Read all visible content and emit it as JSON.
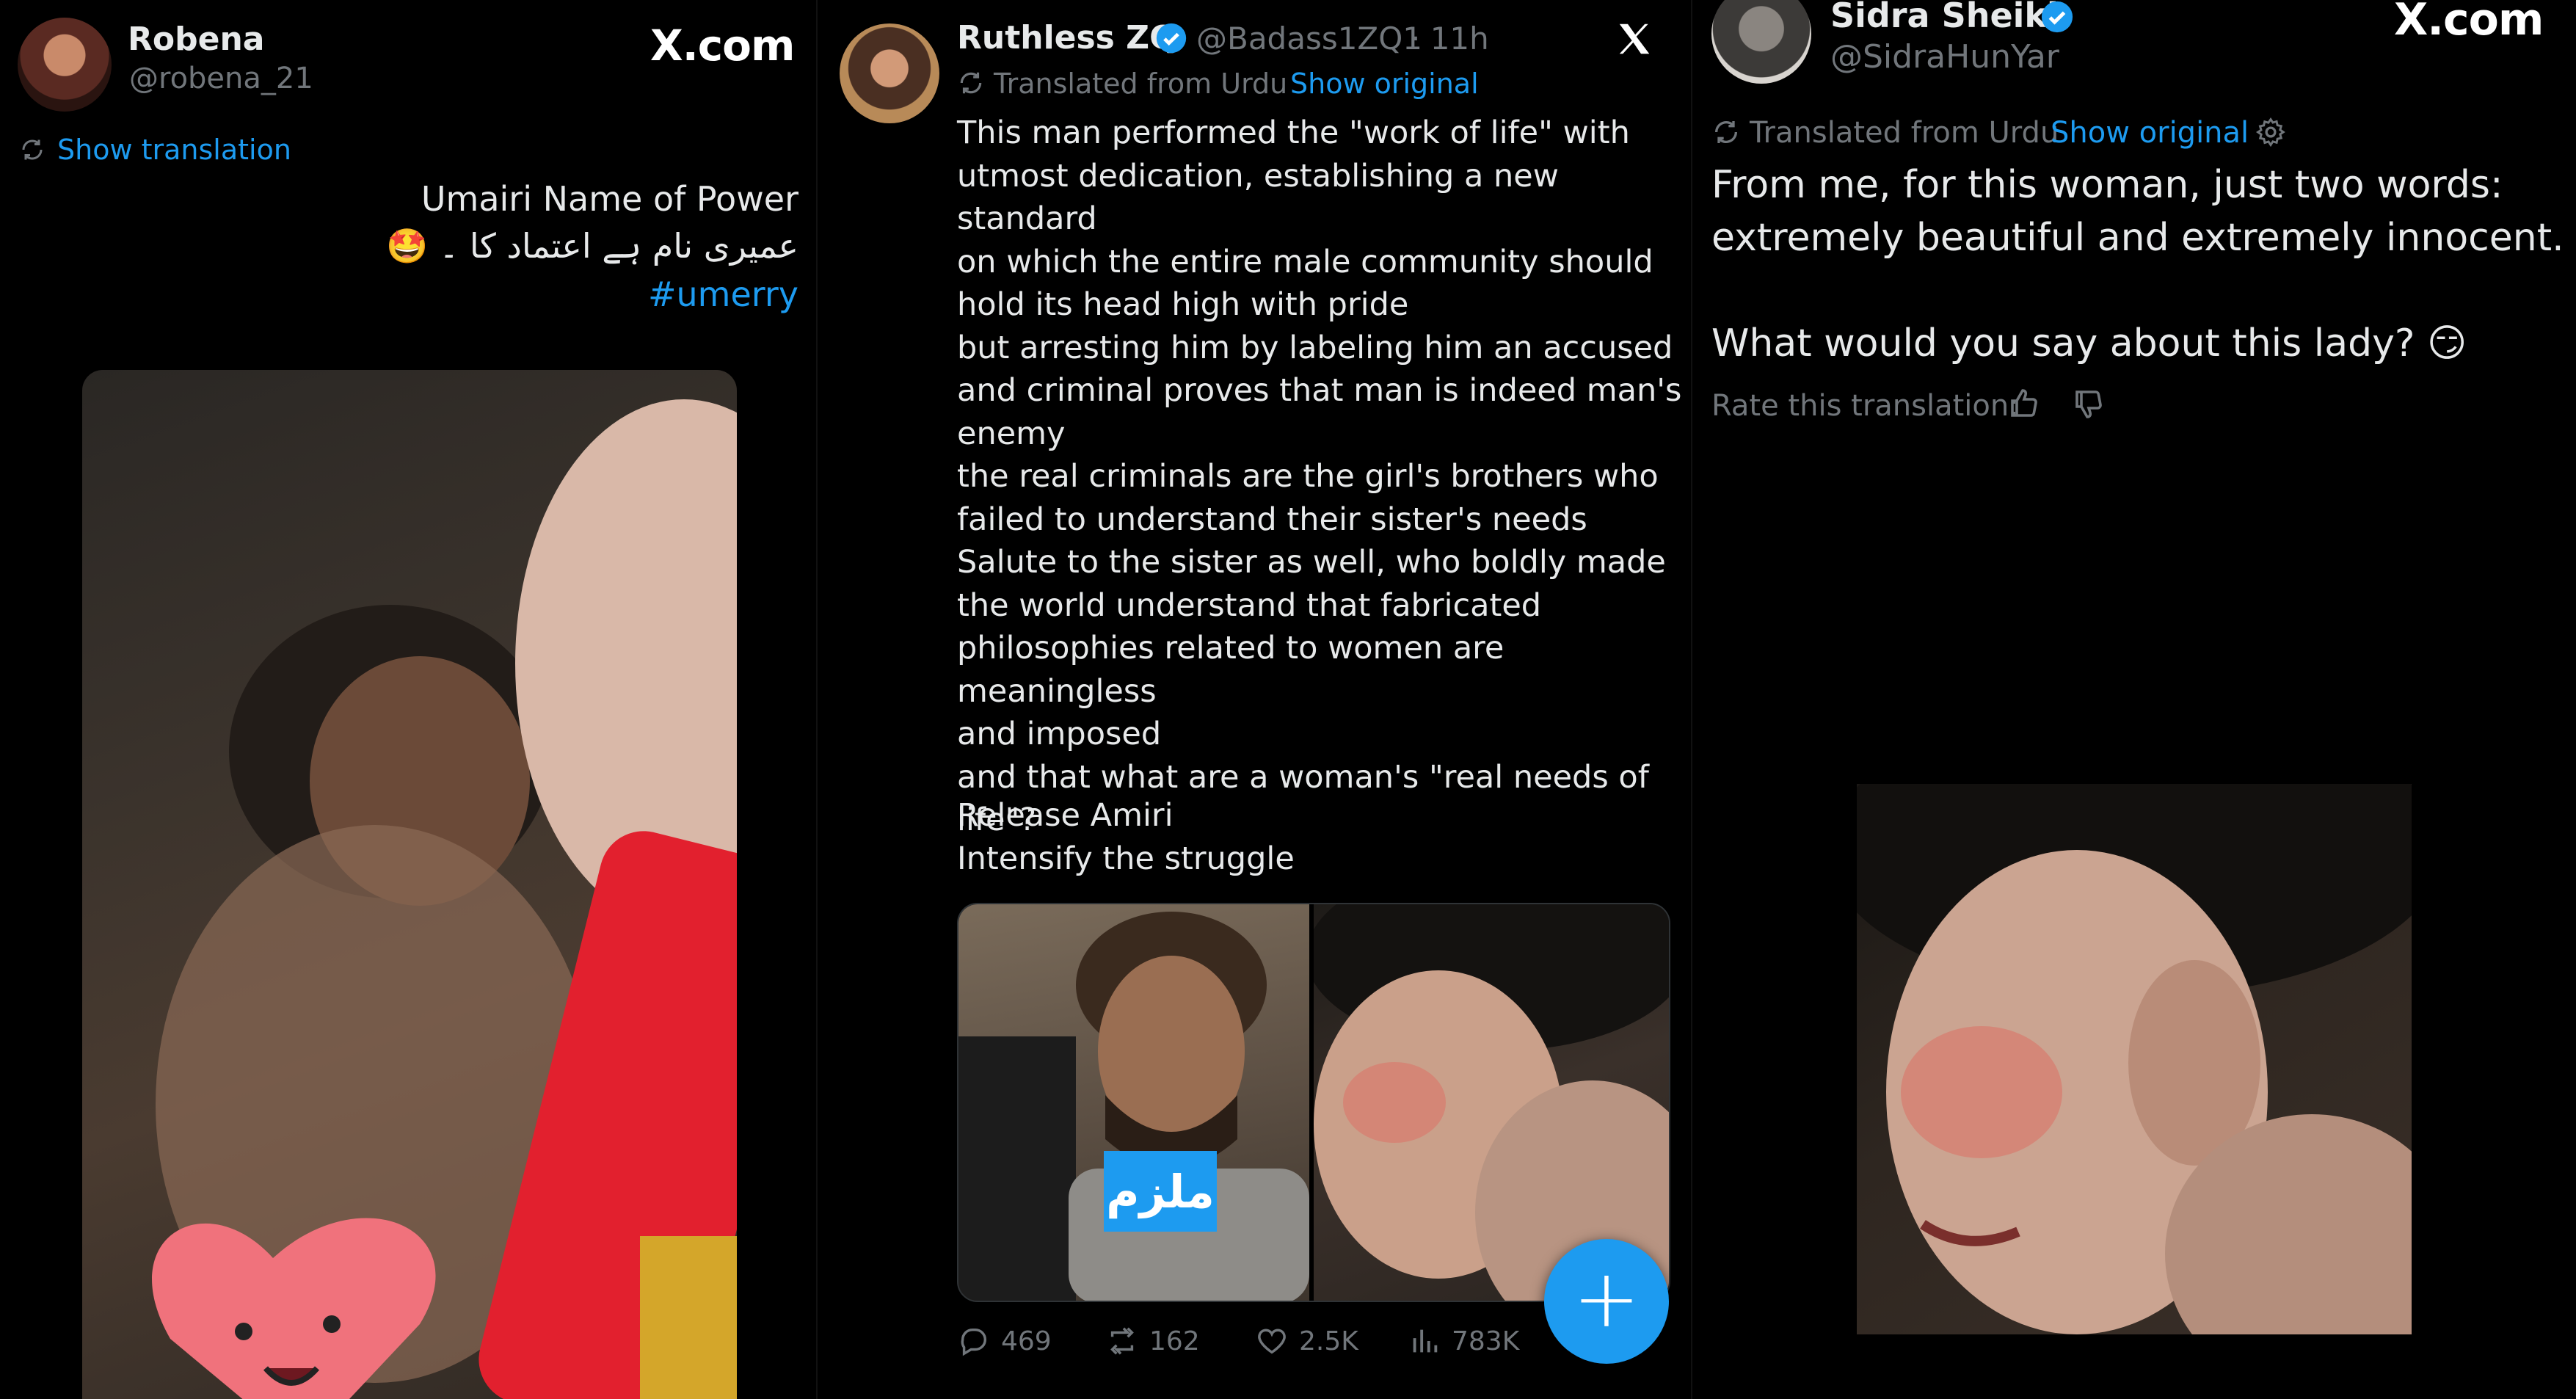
{
  "panel1": {
    "user_name": "Robena",
    "user_handle": "@robena_21",
    "site": "X.com",
    "show_translation": "Show translation",
    "text_line1": "Umairi Name of Power",
    "text_line2": "عمیری نام ہے اعتماد کا ۔ 🤩",
    "hashtag": "#umerry"
  },
  "panel2": {
    "user_name": "Ruthless ZQ",
    "user_handle": "@Badass1ZQ1",
    "time": "· 11h",
    "translated_from": "Translated from Urdu",
    "show_original": "Show original",
    "body_lines": [
      "This man performed the \"work of life\" with",
      "utmost dedication, establishing a new standard",
      "on which the entire male community should",
      "hold its head high with pride",
      "but arresting him by labeling him an accused",
      "and criminal proves that man is indeed man's",
      "enemy",
      "the real criminals are the girl's brothers who",
      "failed to understand their sister's needs",
      "Salute to the sister as well, who boldly made",
      "the world understand that fabricated",
      "philosophies related to women are meaningless",
      "and imposed",
      "and that what are a woman's \"real needs of",
      "life\"?"
    ],
    "closing_line1": "Release Amiri",
    "closing_line2": "Intensify the struggle",
    "media_badge": "ملزم",
    "replies": "469",
    "reposts": "162",
    "likes": "2.5K",
    "views": "783K"
  },
  "panel3": {
    "user_name": "Sidra Sheikh",
    "user_handle": "@SidraHunYar",
    "site": "X.com",
    "translated_from": "Translated from Urdu",
    "show_original": "Show original",
    "text_line1": "From me, for this woman, just two words:",
    "text_line2": "extremely beautiful and extremely innocent.",
    "text_line3": "What would you say about this lady? 😏",
    "rate_label": "Rate this translation:"
  },
  "colors": {
    "background": "#000000",
    "text": "#e7e9ea",
    "muted": "#71767b",
    "accent": "#1d9bf0"
  },
  "icons": [
    "verified-badge-icon",
    "translate-icon",
    "gear-icon",
    "reply-icon",
    "repost-icon",
    "like-icon",
    "views-icon",
    "plus-icon",
    "thumbs-up-icon",
    "thumbs-down-icon",
    "x-logo-icon"
  ]
}
